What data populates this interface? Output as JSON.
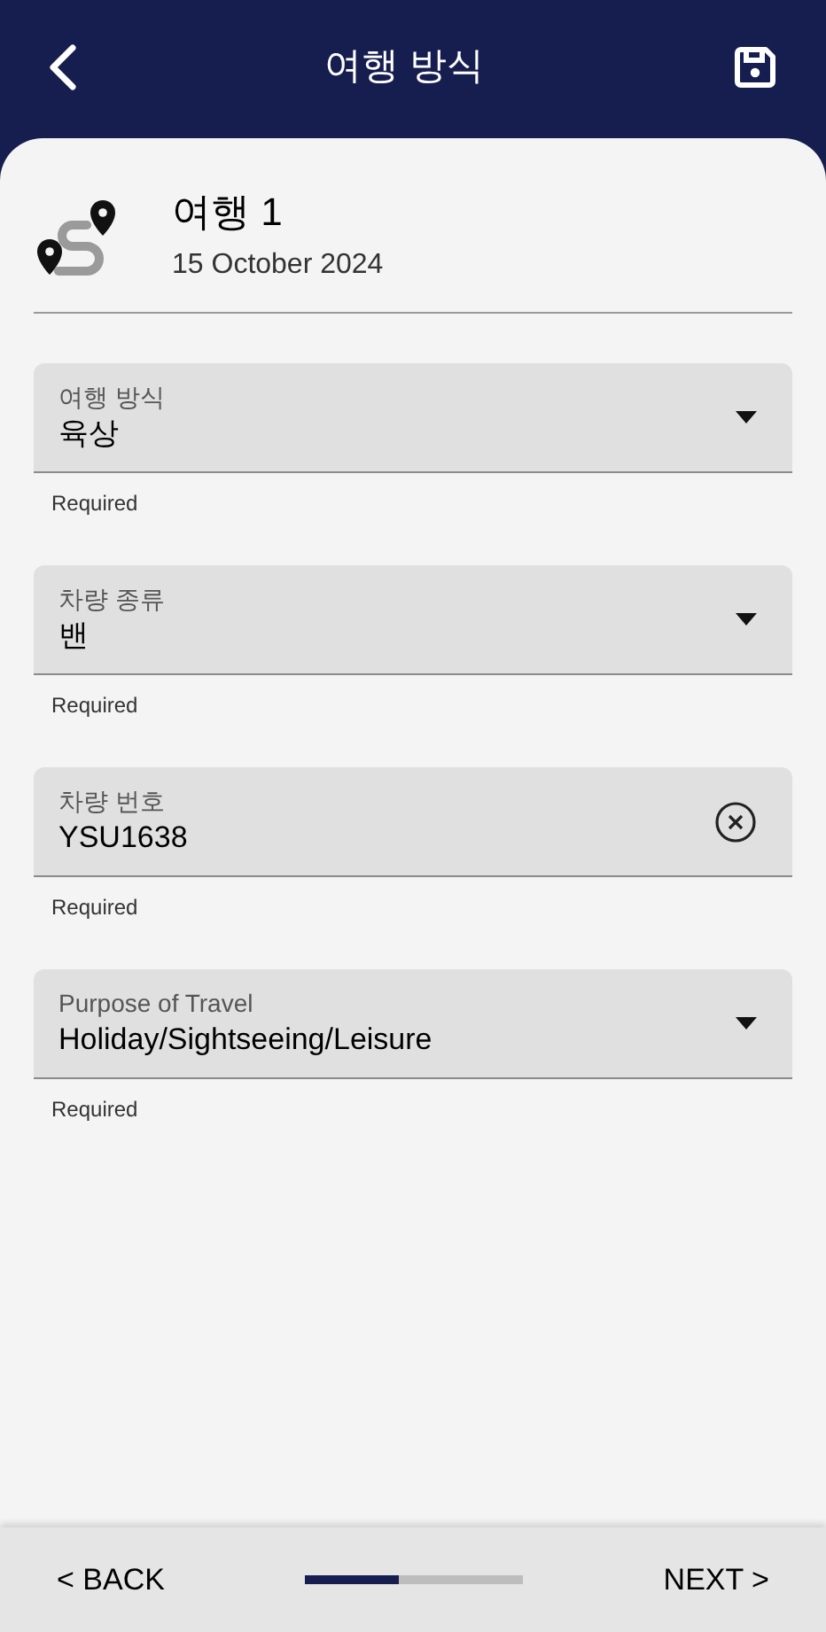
{
  "header": {
    "title": "여행 방식"
  },
  "trip": {
    "name": "여행 1",
    "date": "15 October 2024"
  },
  "fields": [
    {
      "kind": "dropdown",
      "label": "여행 방식",
      "value": "육상",
      "helper": "Required"
    },
    {
      "kind": "dropdown",
      "label": "차량 종류",
      "value": "밴",
      "helper": "Required"
    },
    {
      "kind": "text",
      "label": "차량 번호",
      "value": "YSU1638",
      "helper": "Required"
    },
    {
      "kind": "dropdown",
      "label": "Purpose of Travel",
      "value": "Holiday/Sightseeing/Leisure",
      "helper": "Required"
    }
  ],
  "footer": {
    "back": "< BACK",
    "next": "NEXT >",
    "progress": {
      "level": 0.43
    }
  }
}
